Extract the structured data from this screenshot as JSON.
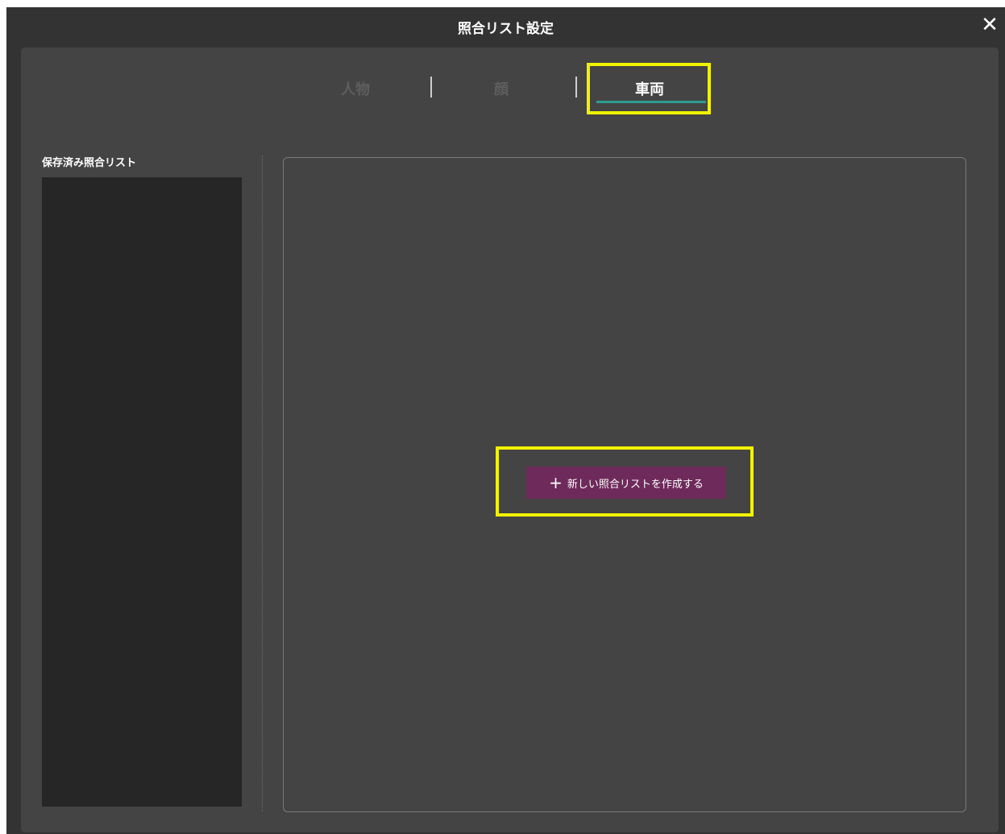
{
  "window": {
    "title": "照合リスト設定",
    "close_icon": "close-icon"
  },
  "tabs": [
    {
      "label": "人物",
      "active": false
    },
    {
      "label": "顔",
      "active": false
    },
    {
      "label": "車両",
      "active": true
    }
  ],
  "sidebar": {
    "title": "保存済み照合リスト",
    "items": []
  },
  "main": {
    "create_button": {
      "label": "新しい照合リストを作成する",
      "icon": "plus-icon"
    }
  },
  "colors": {
    "window_bg": "#333333",
    "panel_bg": "#444444",
    "list_bg": "#262626",
    "accent_underline": "#2e9c92",
    "button_bg": "#6e2a5a",
    "highlight": "#f2f200"
  }
}
